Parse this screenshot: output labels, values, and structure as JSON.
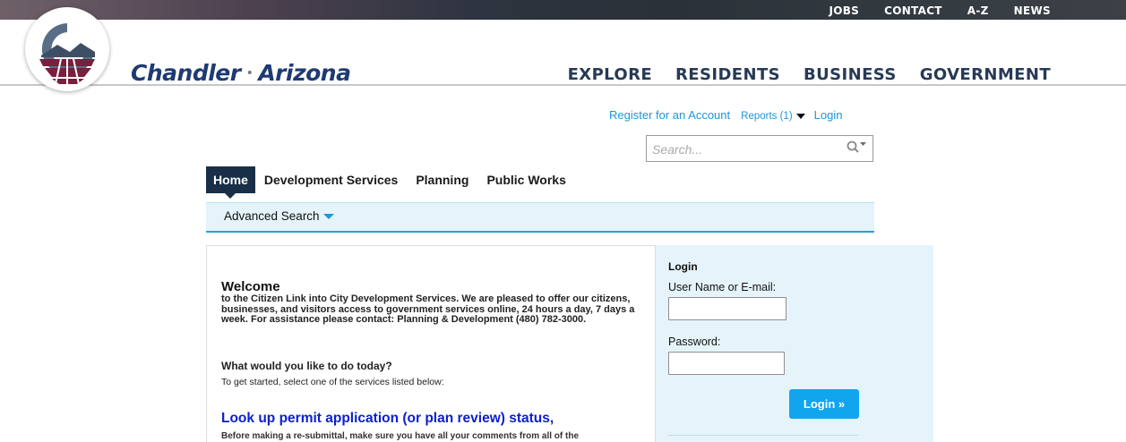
{
  "site_header": {
    "utility_nav": [
      "JOBS",
      "CONTACT",
      "A-Z",
      "NEWS"
    ],
    "brand": {
      "name_left": "Chandler",
      "separator": "•",
      "name_right": "Arizona"
    },
    "main_nav": [
      "EXPLORE",
      "RESIDENTS",
      "BUSINESS",
      "GOVERNMENT"
    ],
    "colors": {
      "brand_blue": "#1f3a73",
      "nav_text": "#273a55",
      "logo_maroon": "#7a1f3d",
      "logo_slate": "#596e86"
    }
  },
  "account_links": {
    "register": "Register for an Account",
    "reports": "Reports (1)",
    "login": "Login",
    "link_color": "#1b97d8"
  },
  "search": {
    "placeholder": "Search...",
    "icon": "magnifier-icon"
  },
  "tabs": [
    {
      "label": "Home",
      "active": true
    },
    {
      "label": "Development Services",
      "active": false
    },
    {
      "label": "Planning",
      "active": false
    },
    {
      "label": "Public Works",
      "active": false
    }
  ],
  "subnav": {
    "advanced_search": "Advanced Search"
  },
  "welcome": {
    "heading": "Welcome",
    "body": "to the Citizen Link into City Development Services. We are pleased to offer our citizens, businesses, and visitors access to government services online, 24 hours a day, 7 days a week.  For assistance please contact:  Planning & Development (480) 782-3000.",
    "question": "What would you like to do today?",
    "instruction": "To get started, select one of the services listed below:",
    "lookup_link": "Look up permit application (or plan review) status,",
    "lookup_desc": "Before making a re-submittal, make sure you have all your comments from all of the"
  },
  "login_panel": {
    "title": "Login",
    "username_label": "User Name or E-mail:",
    "password_label": "Password:",
    "button": "Login »",
    "button_color": "#11a5ee"
  }
}
